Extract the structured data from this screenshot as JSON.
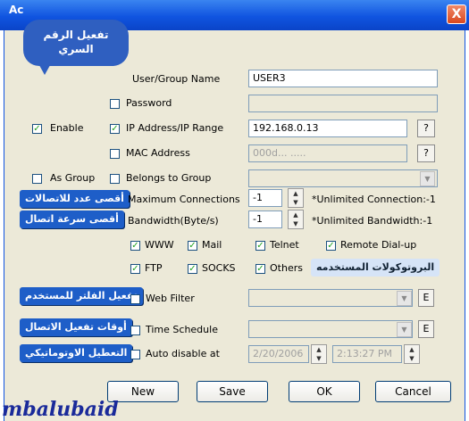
{
  "window": {
    "title": "Ac",
    "close_label": "X"
  },
  "bubble": {
    "line1": "تفعيل الرقم",
    "line2": "السري"
  },
  "form": {
    "user_group_label": "User/Group Name",
    "user_group_value": "USER3",
    "password_label": "Password",
    "enable_label": "Enable",
    "enable_checked": true,
    "ip_label": "IP Address/IP Range",
    "ip_checked": true,
    "ip_value": "192.168.0.13",
    "ip_help": "?",
    "mac_label": "MAC Address",
    "mac_value": "000d... .....",
    "mac_help": "?",
    "as_group_label": "As Group",
    "belongs_label": "Belongs to Group",
    "max_conn_label": "Maximum Connections",
    "max_conn_value": "-1",
    "max_conn_note": "*Unlimited Connection:-1",
    "bandwidth_label": "Bandwidth(Byte/s)",
    "bandwidth_value": "-1",
    "bandwidth_note": "*Unlimited Bandwidth:-1",
    "protocols": {
      "www": "WWW",
      "mail": "Mail",
      "telnet": "Telnet",
      "remote": "Remote Dial-up",
      "ftp": "FTP",
      "socks": "SOCKS",
      "others": "Others"
    },
    "web_filter_label": "Web Filter",
    "time_schedule_label": "Time Schedule",
    "auto_disable_label": "Auto disable at",
    "auto_disable_date": "2/20/2006",
    "auto_disable_time": "2:13:27 PM",
    "e_label": "E"
  },
  "callouts": {
    "max_conn": "أقصى عدد للاتصالات",
    "bandwidth": "أقصى سرعة اتصال",
    "protocols": "البروتوكولات المستخدمه",
    "web_filter": "تفعيل الفلتر للمستخدم",
    "schedule": "أوقات تفعيل الاتصال",
    "auto_disable": "التعطيل الاوتوماتيكي"
  },
  "buttons": {
    "new": "New",
    "save": "Save",
    "ok": "OK",
    "cancel": "Cancel"
  },
  "signature": "mbalubaid",
  "colors": {
    "titlebar": "#1054e0",
    "dialog_bg": "#ece9d8",
    "callout": "#1e5ec8",
    "check": "#21a121"
  }
}
